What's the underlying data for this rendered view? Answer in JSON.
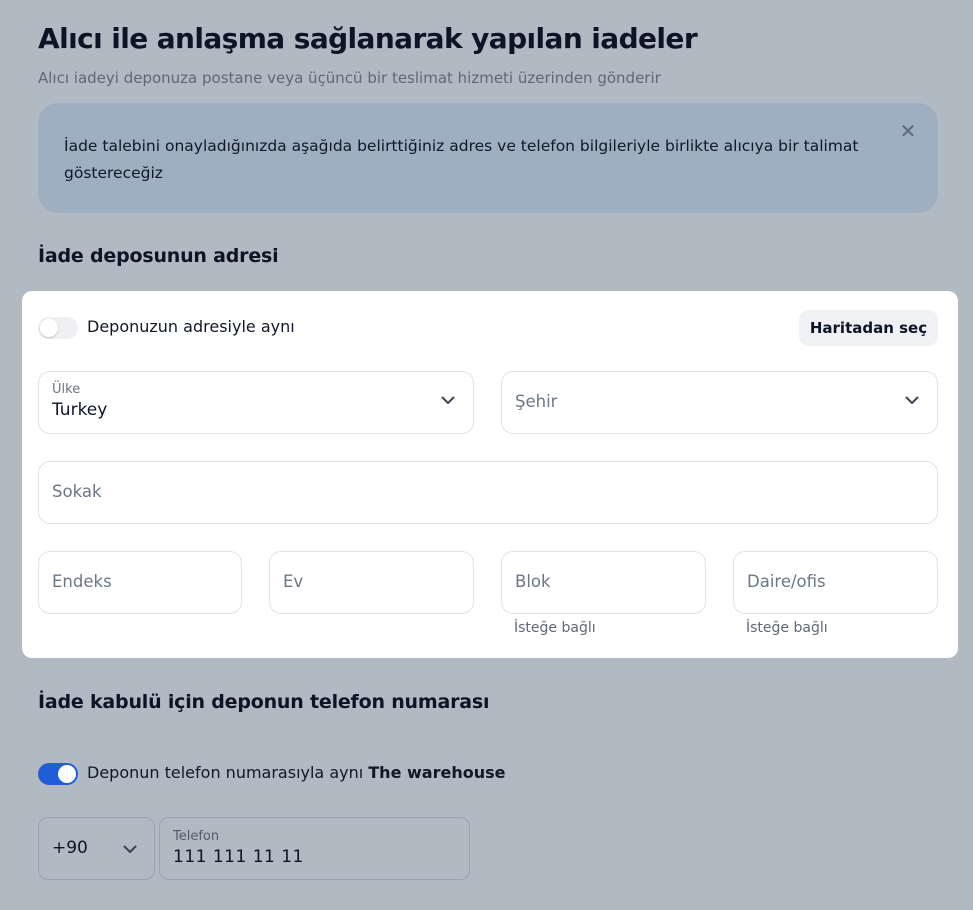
{
  "page": {
    "title": "Alıcı ile anlaşma sağlanarak yapılan iadeler",
    "subtitle": "Alıcı iadeyi deponuza postane veya üçüncü bir teslimat hizmeti üzerinden gönderir"
  },
  "notice": {
    "text": "İade talebini onayladığınızda aşağıda belirttiğiniz adres ve telefon bilgileriyle birlikte alıcıya bir talimat göstereceğiz",
    "close_icon": "close-icon"
  },
  "address_section": {
    "title": "İade deposunun adresi",
    "same_as_warehouse": {
      "label": "Deponuzun adresiyle aynı",
      "checked": false
    },
    "map_button": "Haritadan seç",
    "country": {
      "label": "Ülke",
      "value": "Turkey"
    },
    "city": {
      "placeholder": "Şehir"
    },
    "street": {
      "placeholder": "Sokak"
    },
    "postcode": {
      "placeholder": "Endeks"
    },
    "house": {
      "placeholder": "Ev"
    },
    "block": {
      "placeholder": "Blok",
      "hint": "İsteğe bağlı"
    },
    "apartment": {
      "placeholder": "Daire/ofis",
      "hint": "İsteğe bağlı"
    }
  },
  "phone_section": {
    "title": "İade kabulü için deponun telefon numarası",
    "same_phone": {
      "label": "Deponun telefon numarasıyla aynı",
      "warehouse": "The warehouse",
      "checked": true
    },
    "country_code": "+90",
    "phone": {
      "label": "Telefon",
      "value": "111 111 11 11"
    }
  },
  "colors": {
    "background": "#b1b9c2",
    "notice": "#9eafc2",
    "accent": "#1e5ed8"
  }
}
